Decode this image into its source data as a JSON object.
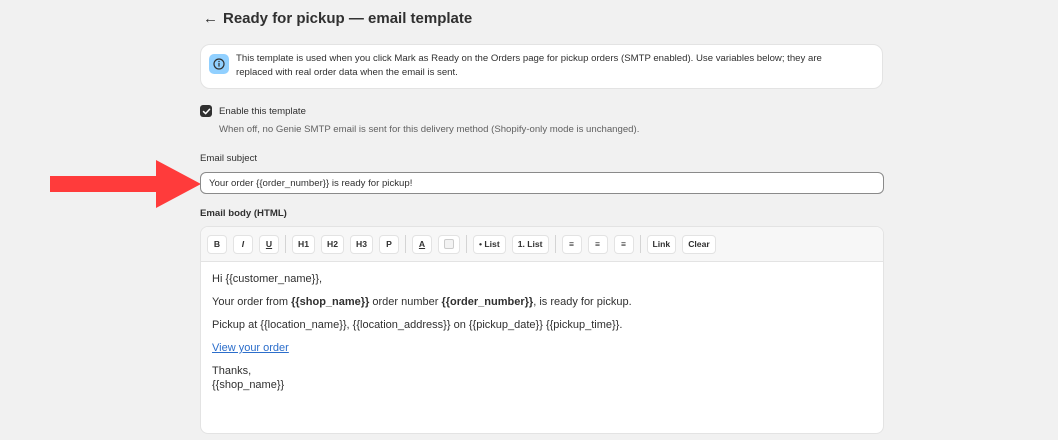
{
  "header": {
    "back_icon": "arrow-left-icon",
    "title": "Ready for pickup — email template"
  },
  "banner": {
    "icon": "info-icon",
    "text_line1": "This template is used when you click Mark as Ready on the Orders page for pickup orders (SMTP enabled). Use variables below; they are",
    "text_line2": "replaced with real order data when the email is sent."
  },
  "enable": {
    "checked": true,
    "label": "Enable this template",
    "help": "When off, no Genie SMTP email is sent for this delivery method (Shopify-only mode is unchanged)."
  },
  "subject": {
    "label": "Email subject",
    "value": "Your order {{order_number}} is ready for pickup!"
  },
  "body": {
    "label": "Email body (HTML)",
    "toolbar": {
      "bold": "B",
      "italic": "I",
      "underline": "U",
      "h1": "H1",
      "h2": "H2",
      "h3": "H3",
      "p": "P",
      "color": "A",
      "bullet_list": "• List",
      "numbered_list": "1. List",
      "align_left": "≡",
      "align_center": "≡",
      "align_right": "≡",
      "link": "Link",
      "clear": "Clear"
    },
    "content": {
      "greeting": "Hi {{customer_name}},",
      "line2_a": "Your order from ",
      "line2_b": "{{shop_name}}",
      "line2_c": " order number ",
      "line2_d": "{{order_number}}",
      "line2_e": ", is ready for pickup.",
      "line3": "Pickup at {{location_name}}, {{location_address}} on {{pickup_date}} {{pickup_time}}.",
      "link": "View your order",
      "thanks": "Thanks,",
      "signoff": "{{shop_name}}"
    }
  },
  "colors": {
    "annotation_arrow": "#ff3b3b",
    "info_icon_bg": "#91d0ff",
    "link": "#2c6ecb"
  }
}
